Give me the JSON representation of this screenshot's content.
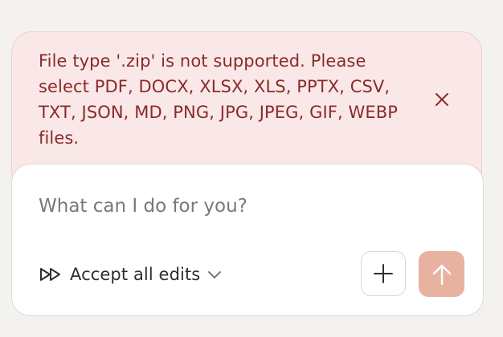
{
  "error": {
    "message": "File type '.zip' is not supported. Please select PDF, DOCX, XLSX, XLS, PPTX, CSV, TXT, JSON, MD, PNG, JPG, JPEG, GIF, WEBP files.",
    "close_icon": "close-icon",
    "text_color": "#8a2a2a",
    "background_color": "#f9e8e7"
  },
  "composer": {
    "placeholder": "What can I do for you?",
    "value": "",
    "accept_edits_label": "Accept all edits",
    "accept_edits_icon": "fast-forward-icon",
    "dropdown_icon": "chevron-down-icon",
    "add_icon": "plus-icon",
    "send_icon": "arrow-up-icon",
    "send_color": "#e8b2a1"
  }
}
